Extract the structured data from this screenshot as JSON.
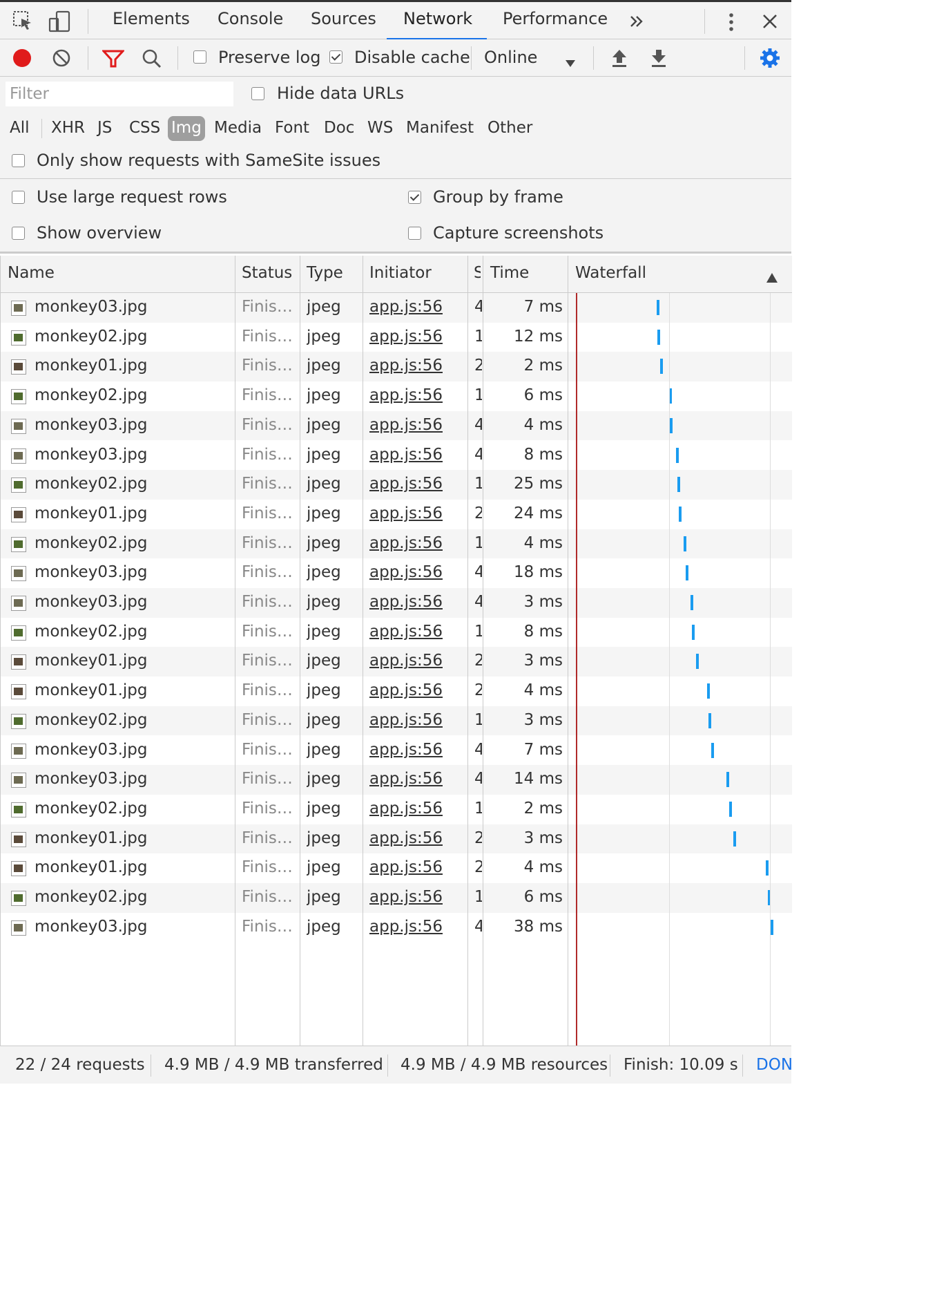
{
  "tabs": [
    "Elements",
    "Console",
    "Sources",
    "Network",
    "Performance"
  ],
  "active_tab": "Network",
  "toolbar": {
    "preserve_log": "Preserve log",
    "preserve_log_checked": false,
    "disable_cache": "Disable cache",
    "disable_cache_checked": true,
    "throttle": "Online"
  },
  "filter": {
    "placeholder": "Filter",
    "hide_data_urls": "Hide data URLs",
    "types": [
      "All",
      "XHR",
      "JS",
      "CSS",
      "Img",
      "Media",
      "Font",
      "Doc",
      "WS",
      "Manifest",
      "Other"
    ],
    "active_type": "Img",
    "samesite": "Only show requests with SameSite issues"
  },
  "settings": {
    "large_rows": "Use large request rows",
    "group_by_frame": "Group by frame",
    "show_overview": "Show overview",
    "capture_screenshots": "Capture screenshots"
  },
  "columns": {
    "name": "Name",
    "status": "Status",
    "type": "Type",
    "initiator": "Initiator",
    "size": "S",
    "time": "Time",
    "waterfall": "Waterfall"
  },
  "rows": [
    {
      "name": "monkey03.jpg",
      "status": "Finis…",
      "type": "jpeg",
      "initiator": "app.js:56",
      "size": "4",
      "time": "7 ms",
      "wf": 0.41
    },
    {
      "name": "monkey02.jpg",
      "status": "Finis…",
      "type": "jpeg",
      "initiator": "app.js:56",
      "size": "1",
      "time": "12 ms",
      "wf": 0.415
    },
    {
      "name": "monkey01.jpg",
      "status": "Finis…",
      "type": "jpeg",
      "initiator": "app.js:56",
      "size": "2",
      "time": "2 ms",
      "wf": 0.43
    },
    {
      "name": "monkey02.jpg",
      "status": "Finis…",
      "type": "jpeg",
      "initiator": "app.js:56",
      "size": "1",
      "time": "6 ms",
      "wf": 0.475
    },
    {
      "name": "monkey03.jpg",
      "status": "Finis…",
      "type": "jpeg",
      "initiator": "app.js:56",
      "size": "4",
      "time": "4 ms",
      "wf": 0.48
    },
    {
      "name": "monkey03.jpg",
      "status": "Finis…",
      "type": "jpeg",
      "initiator": "app.js:56",
      "size": "4",
      "time": "8 ms",
      "wf": 0.51
    },
    {
      "name": "monkey02.jpg",
      "status": "Finis…",
      "type": "jpeg",
      "initiator": "app.js:56",
      "size": "1",
      "time": "25 ms",
      "wf": 0.517
    },
    {
      "name": "monkey01.jpg",
      "status": "Finis…",
      "type": "jpeg",
      "initiator": "app.js:56",
      "size": "2",
      "time": "24 ms",
      "wf": 0.524
    },
    {
      "name": "monkey02.jpg",
      "status": "Finis…",
      "type": "jpeg",
      "initiator": "app.js:56",
      "size": "1",
      "time": "4 ms",
      "wf": 0.55
    },
    {
      "name": "monkey03.jpg",
      "status": "Finis…",
      "type": "jpeg",
      "initiator": "app.js:56",
      "size": "4",
      "time": "18 ms",
      "wf": 0.56
    },
    {
      "name": "monkey03.jpg",
      "status": "Finis…",
      "type": "jpeg",
      "initiator": "app.js:56",
      "size": "4",
      "time": "3 ms",
      "wf": 0.585
    },
    {
      "name": "monkey02.jpg",
      "status": "Finis…",
      "type": "jpeg",
      "initiator": "app.js:56",
      "size": "1",
      "time": "8 ms",
      "wf": 0.592
    },
    {
      "name": "monkey01.jpg",
      "status": "Finis…",
      "type": "jpeg",
      "initiator": "app.js:56",
      "size": "2",
      "time": "3 ms",
      "wf": 0.613
    },
    {
      "name": "monkey01.jpg",
      "status": "Finis…",
      "type": "jpeg",
      "initiator": "app.js:56",
      "size": "2",
      "time": "4 ms",
      "wf": 0.67
    },
    {
      "name": "monkey02.jpg",
      "status": "Finis…",
      "type": "jpeg",
      "initiator": "app.js:56",
      "size": "1",
      "time": "3 ms",
      "wf": 0.677
    },
    {
      "name": "monkey03.jpg",
      "status": "Finis…",
      "type": "jpeg",
      "initiator": "app.js:56",
      "size": "4",
      "time": "7 ms",
      "wf": 0.69
    },
    {
      "name": "monkey03.jpg",
      "status": "Finis…",
      "type": "jpeg",
      "initiator": "app.js:56",
      "size": "4",
      "time": "14 ms",
      "wf": 0.77
    },
    {
      "name": "monkey02.jpg",
      "status": "Finis…",
      "type": "jpeg",
      "initiator": "app.js:56",
      "size": "1",
      "time": "2 ms",
      "wf": 0.785
    },
    {
      "name": "monkey01.jpg",
      "status": "Finis…",
      "type": "jpeg",
      "initiator": "app.js:56",
      "size": "2",
      "time": "3 ms",
      "wf": 0.806
    },
    {
      "name": "monkey01.jpg",
      "status": "Finis…",
      "type": "jpeg",
      "initiator": "app.js:56",
      "size": "2",
      "time": "4 ms",
      "wf": 0.97
    },
    {
      "name": "monkey02.jpg",
      "status": "Finis…",
      "type": "jpeg",
      "initiator": "app.js:56",
      "size": "1",
      "time": "6 ms",
      "wf": 0.983
    },
    {
      "name": "monkey03.jpg",
      "status": "Finis…",
      "type": "jpeg",
      "initiator": "app.js:56",
      "size": "4",
      "time": "38 ms",
      "wf": 0.997
    }
  ],
  "footer": {
    "requests": "22 / 24 requests",
    "transferred": "4.9 MB / 4.9 MB transferred",
    "resources": "4.9 MB / 4.9 MB resources",
    "finish": "Finish: 10.09 s",
    "dom": "DON"
  },
  "colors": {
    "accent": "#1a73e8",
    "record": "#e01b1b",
    "waterfall_bar": "#1a9cf0",
    "load_line": "#b02a2a",
    "settings_gear": "#1a73e8"
  },
  "icons": {
    "inspect": "inspect-element-icon",
    "device": "device-toolbar-icon",
    "more_tabs": "chevron-double-right-icon",
    "menu": "kebab-menu-icon",
    "close": "close-icon",
    "record": "record-icon",
    "clear": "clear-icon",
    "filter": "filter-icon",
    "search": "search-icon",
    "upload": "import-har-icon",
    "download": "export-har-icon",
    "settings": "gear-icon",
    "sort": "sort-ascending-icon"
  }
}
